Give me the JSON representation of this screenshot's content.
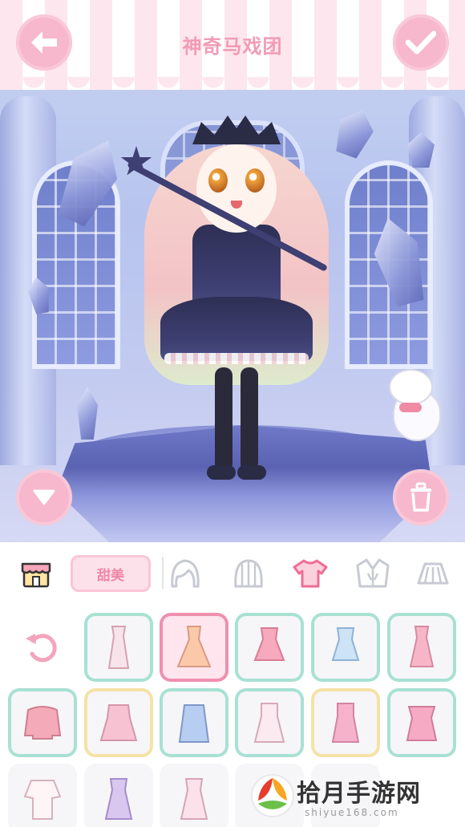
{
  "header": {
    "title": "神奇马戏团",
    "back_icon": "arrow-left-icon",
    "confirm_icon": "check-icon"
  },
  "scene": {
    "collapse_icon": "triangle-down-icon",
    "delete_icon": "trash-icon"
  },
  "tabs": {
    "shop_icon": "shop-icon",
    "style_label": "甜美",
    "categories": [
      "hair-front-icon",
      "hair-back-icon",
      "top-icon",
      "jacket-icon",
      "skirt-icon"
    ],
    "selected": "top-icon"
  },
  "items": {
    "reset_icon": "undo-icon",
    "rows": [
      [
        {
          "name": "reset",
          "border": "none"
        },
        {
          "name": "white-slip-dress",
          "border": "teal",
          "color": "#f7e4ea"
        },
        {
          "name": "peach-ruffle-dress",
          "border": "pink",
          "selected": true,
          "color": "#fbc9a9"
        },
        {
          "name": "pink-cami-top",
          "border": "teal",
          "color": "#f7a9bd"
        },
        {
          "name": "blue-lace-cami",
          "border": "teal",
          "color": "#cde3f6"
        },
        {
          "name": "pink-cross-dress",
          "border": "teal",
          "color": "#f7b6c8"
        }
      ],
      [
        {
          "name": "pink-knit-sweater",
          "border": "teal",
          "color": "#f4aab8"
        },
        {
          "name": "pink-babydoll",
          "border": "yellow",
          "color": "#f7c3d3"
        },
        {
          "name": "blue-bow-dress",
          "border": "teal",
          "color": "#b7cdf1"
        },
        {
          "name": "white-rose-dress",
          "border": "teal",
          "color": "#fbeaf0"
        },
        {
          "name": "pink-heart-dress",
          "border": "yellow",
          "color": "#f6b2cb"
        },
        {
          "name": "pink-collar-dress",
          "border": "teal",
          "color": "#f6aac3"
        }
      ],
      [
        {
          "name": "white-long-tee",
          "border": "none",
          "color": "#fff4f6"
        },
        {
          "name": "lilac-slip",
          "border": "none",
          "color": "#d9c7f0"
        },
        {
          "name": "polka-cami",
          "border": "none",
          "color": "#fbe2ea"
        },
        {
          "name": "hidden-item-a",
          "border": "none",
          "color": "#f8f0f2"
        },
        {
          "name": "hidden-item-b",
          "border": "none",
          "color": "#f8f0f2"
        }
      ]
    ]
  },
  "watermark": {
    "text": "拾月手游网",
    "sub": "shiyue168.com"
  },
  "colors": {
    "accent_pink": "#f7b7cc",
    "title_pink": "#f29bb6",
    "tab_selected": "#ee6e95"
  }
}
